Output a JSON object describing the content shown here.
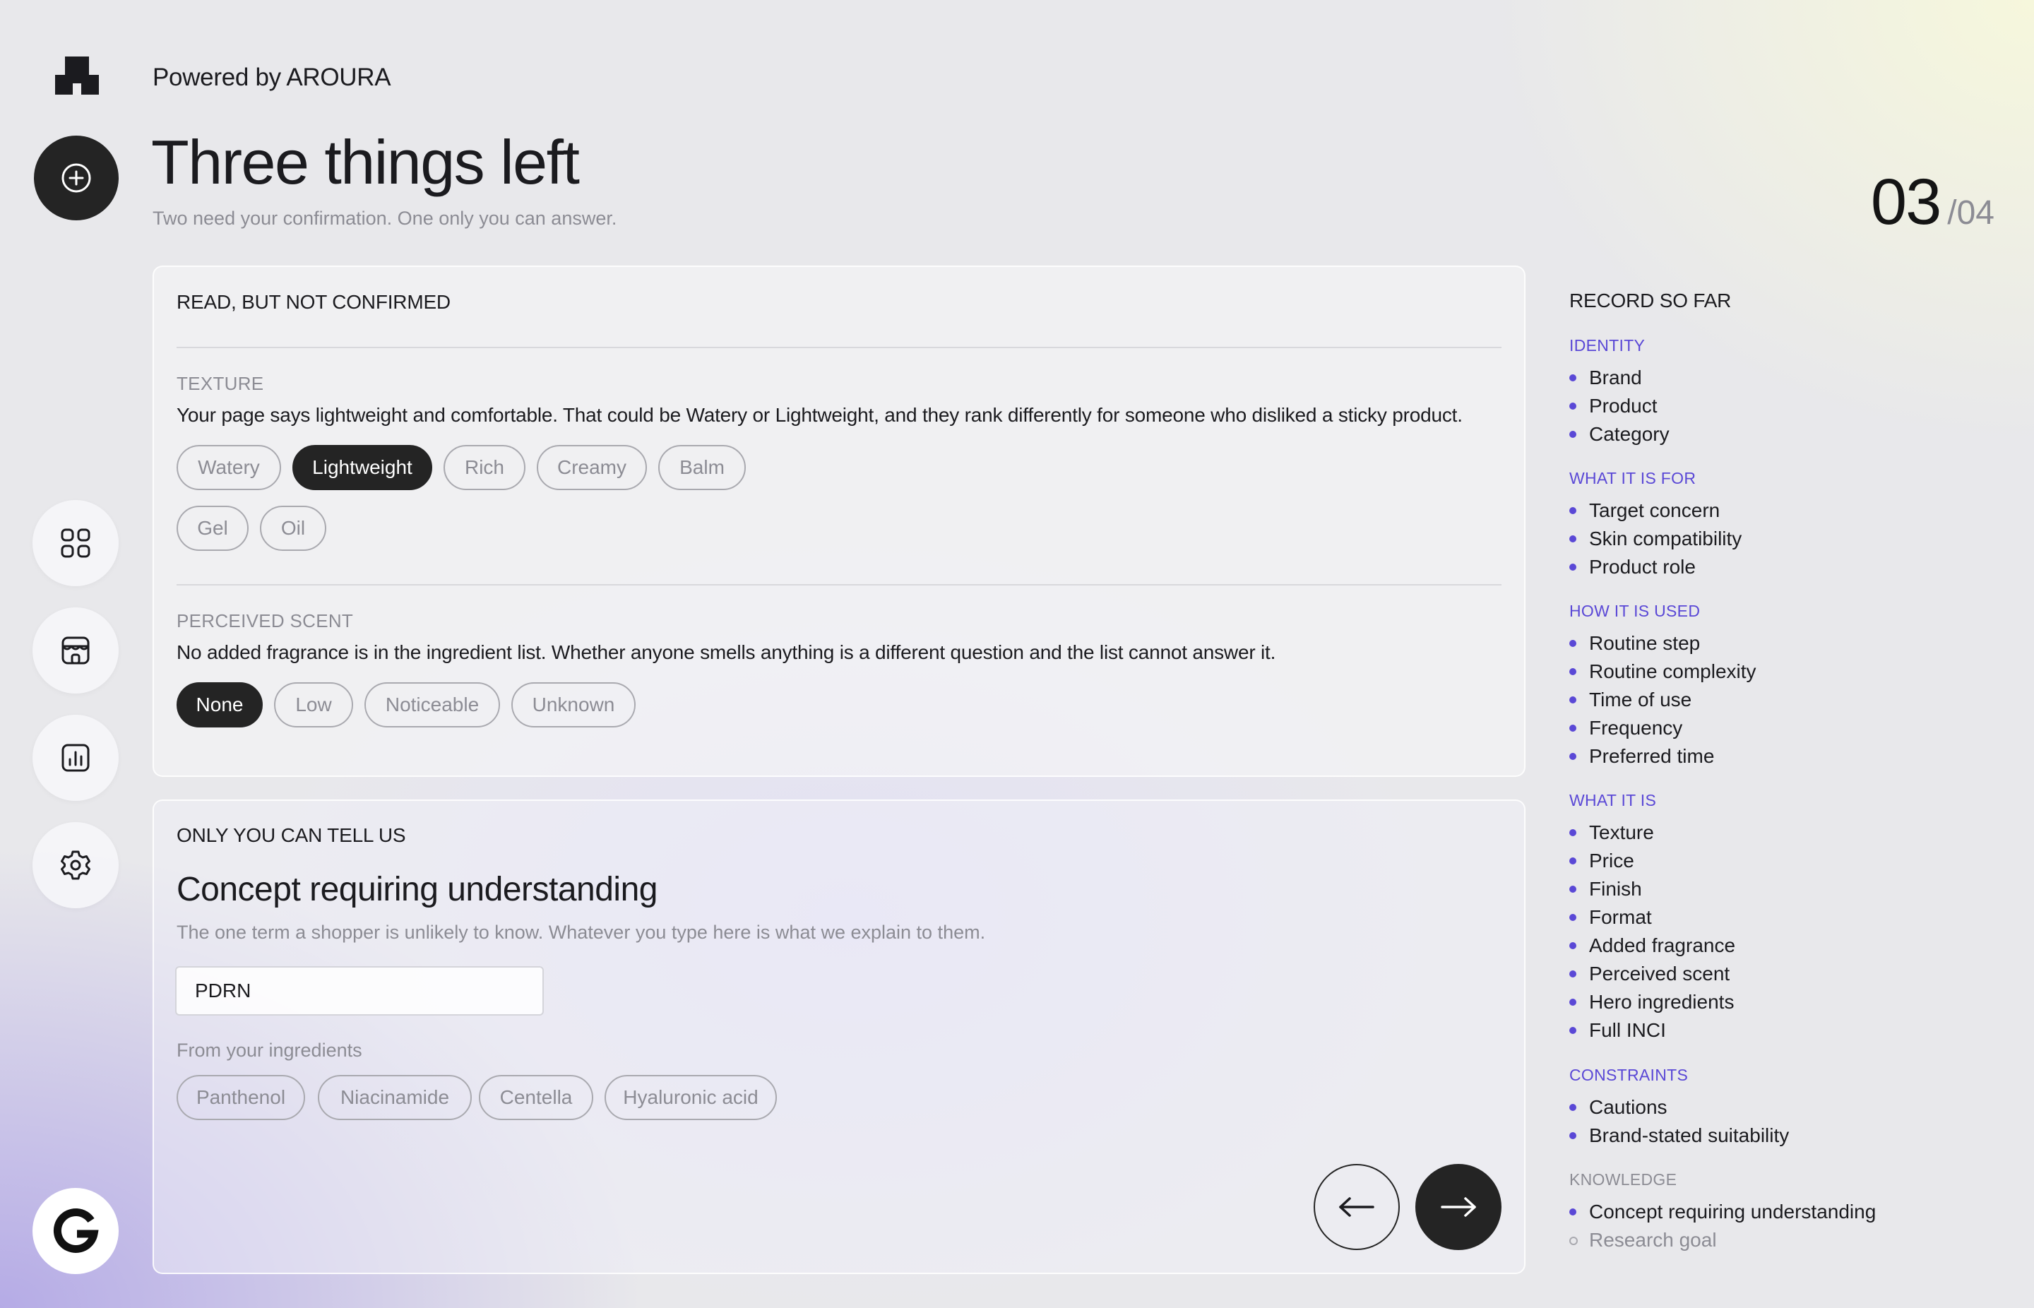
{
  "header": {
    "powered_by": "Powered by AROURA",
    "title": "Three things left",
    "subtitle": "Two need your confirmation. One only you can answer.",
    "step_current": "03",
    "step_total": "/04"
  },
  "icons": {
    "logo": "aroura-logo-icon",
    "add": "plus-circle-icon",
    "grid": "grid-icon",
    "store": "store-icon",
    "analytics": "chart-icon",
    "settings": "gear-icon",
    "google": "google-g-icon",
    "back": "arrow-left-icon",
    "next": "arrow-right-icon"
  },
  "colors": {
    "accent": "#5a48d6",
    "dark": "#242424",
    "muted": "#8c8c94"
  },
  "confirm_card": {
    "heading": "READ, BUT NOT CONFIRMED",
    "texture": {
      "label": "TEXTURE",
      "description": "Your page says lightweight and comfortable. That could be Watery or Lightweight, and they rank differently for someone who disliked a sticky product.",
      "options": [
        "Watery",
        "Lightweight",
        "Rich",
        "Creamy",
        "Balm",
        "Gel",
        "Oil"
      ],
      "selected": "Lightweight"
    },
    "scent": {
      "label": "PERCEIVED SCENT",
      "description": "No added fragrance is in the ingredient list. Whether anyone smells anything is a different question and the list cannot answer it.",
      "options": [
        "None",
        "Low",
        "Noticeable",
        "Unknown"
      ],
      "selected": "None"
    }
  },
  "knowledge_card": {
    "heading": "ONLY YOU CAN TELL US",
    "title": "Concept requiring understanding",
    "description": "The one term a shopper is unlikely to know. Whatever you type here is what we explain to them.",
    "input_value": "PDRN",
    "from_label": "From your ingredients",
    "suggestions": [
      "Panthenol",
      "Niacinamide",
      "Centella",
      "Hyaluronic acid"
    ]
  },
  "record": {
    "heading": "RECORD SO FAR",
    "groups": [
      {
        "title": "IDENTITY",
        "items": [
          "Brand",
          "Product",
          "Category"
        ]
      },
      {
        "title": "WHAT IT IS FOR",
        "items": [
          "Target concern",
          "Skin compatibility",
          "Product role"
        ]
      },
      {
        "title": "HOW IT IS USED",
        "items": [
          "Routine step",
          "Routine complexity",
          "Time of use",
          "Frequency",
          "Preferred time"
        ]
      },
      {
        "title": "WHAT IT IS",
        "items": [
          "Texture",
          "Price",
          "Finish",
          "Format",
          "Added fragrance",
          "Perceived scent",
          "Hero ingredients",
          "Full INCI"
        ]
      },
      {
        "title": "CONSTRAINTS",
        "items": [
          "Cautions",
          "Brand-stated suitability"
        ]
      },
      {
        "title": "KNOWLEDGE",
        "items": [
          "Concept requiring understanding",
          "Research goal"
        ],
        "pending": [
          "Research goal"
        ]
      }
    ]
  }
}
